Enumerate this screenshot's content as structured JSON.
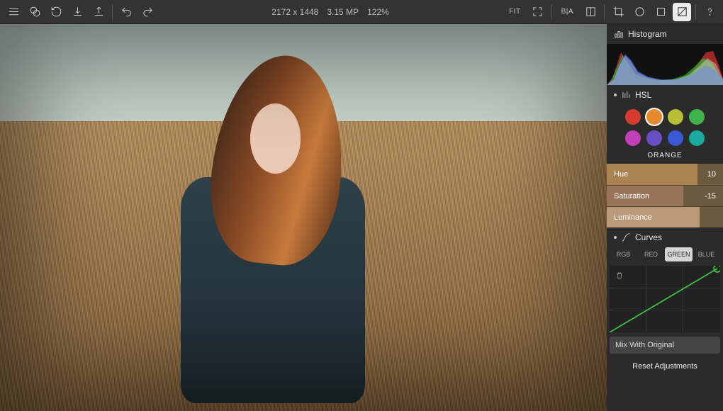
{
  "toolbar": {
    "dimensions": "2172 x 1448",
    "megapixels": "3.15 MP",
    "zoom": "122%",
    "fit_label": "FIT",
    "ba_label": "B|A"
  },
  "sidebar": {
    "histogram_title": "Histogram",
    "hsl": {
      "title": "HSL",
      "colors": [
        {
          "name": "red",
          "hex": "#d63c2e"
        },
        {
          "name": "orange",
          "hex": "#e58a2e"
        },
        {
          "name": "yellow",
          "hex": "#b9bf33"
        },
        {
          "name": "green",
          "hex": "#3eb34a"
        },
        {
          "name": "magenta",
          "hex": "#c23fb8"
        },
        {
          "name": "purple",
          "hex": "#6a4fc4"
        },
        {
          "name": "blue",
          "hex": "#3a57d6"
        },
        {
          "name": "aqua",
          "hex": "#1aa9a0"
        }
      ],
      "selected_color": "ORANGE",
      "sliders": {
        "hue": {
          "label": "Hue",
          "value": "10",
          "fill_pct": 78
        },
        "saturation": {
          "label": "Saturation",
          "value": "-15",
          "fill_pct": 66
        },
        "luminance": {
          "label": "Luminance",
          "value": "",
          "fill_pct": 80
        }
      }
    },
    "curves": {
      "title": "Curves",
      "tabs": {
        "rgb": "RGB",
        "red": "RED",
        "green": "GREEN",
        "blue": "BLUE"
      },
      "active_tab": "green"
    },
    "mix_label": "Mix With Original",
    "reset_label": "Reset Adjustments"
  }
}
